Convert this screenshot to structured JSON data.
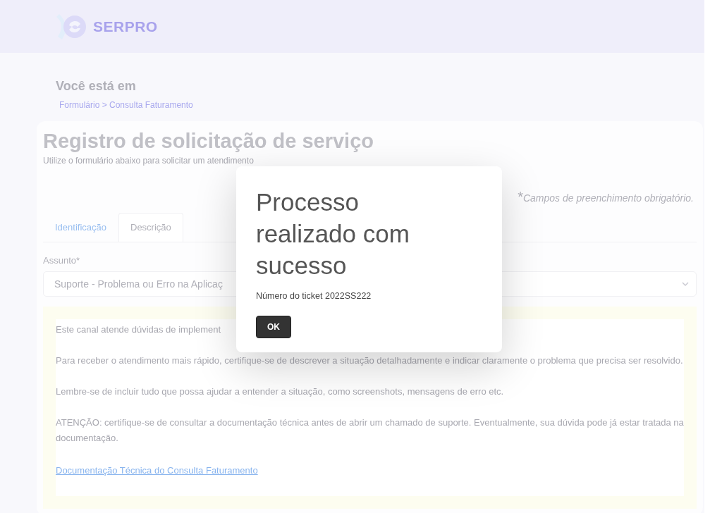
{
  "header": {
    "brand": "SERPRO"
  },
  "breadcrumb": {
    "heading": "Você está em",
    "path": "Formulário > Consulta Faturamento"
  },
  "form": {
    "title": "Registro de solicitação de serviço",
    "subtitle": "Utilize o formulário abaixo para solicitar um atendimento",
    "required_mark": "*",
    "required_note": "Campos de preenchimento obrigatório.",
    "tabs": [
      {
        "label": "Identificação",
        "selected": false
      },
      {
        "label": "Descrição",
        "selected": true
      }
    ],
    "subject": {
      "label": "Assunto*",
      "value": "Suporte - Problema ou Erro na Aplicaç"
    },
    "notice": {
      "paragraphs": [
        "Este canal atende dúvidas de implement",
        "Para receber o atendimento mais rápido, certifique-se de descrever a situação detalhadamente e indicar claramente o problema que precisa ser resolvido.",
        "Lembre-se de incluir tudo que possa ajudar a entender a situação, como screenshots, mensagens de erro etc.",
        "ATENÇÃO: certifique-se de consultar a documentação técnica antes de abrir um chamado de suporte. Eventualmente, sua dúvida pode já estar tratada na documentação."
      ],
      "link": "Documentação Técnica do Consulta Faturamento"
    }
  },
  "dialog": {
    "title": "Processo realizado com sucesso",
    "message": "Número do ticket 2022SS222",
    "button": "OK"
  }
}
